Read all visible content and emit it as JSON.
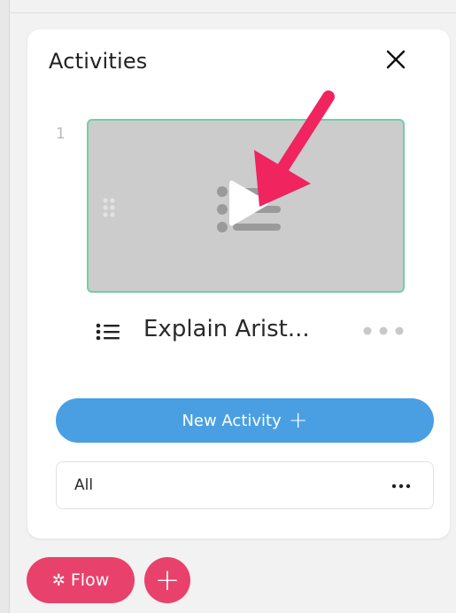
{
  "panel": {
    "title": "Activities"
  },
  "activity": {
    "index": "1",
    "title": "Explain Arist..."
  },
  "actions": {
    "new_activity_label": "New Activity"
  },
  "filter": {
    "selected": "All"
  },
  "footer": {
    "flow_label": "Flow"
  },
  "colors": {
    "accent_blue": "#4a9fe2",
    "accent_pink": "#e8426c",
    "thumb_border": "#6fd1a6"
  }
}
